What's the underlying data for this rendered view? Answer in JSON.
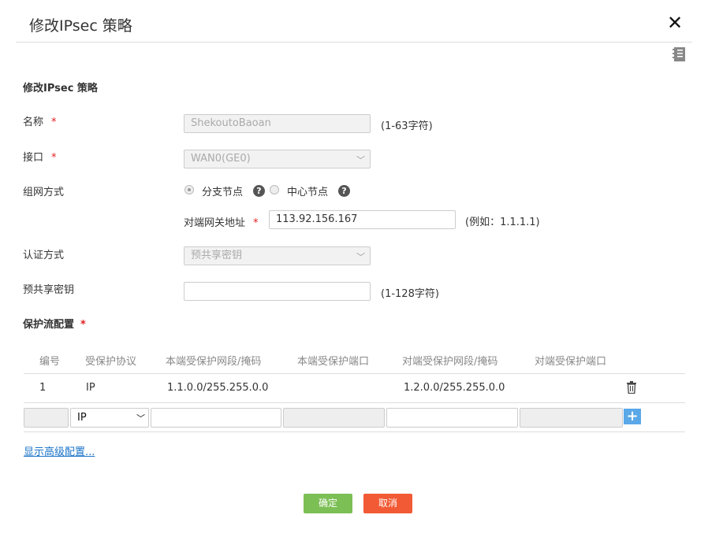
{
  "dialog": {
    "title": "修改IPsec 策略",
    "close_icon": "close-icon",
    "help_icon": "document-icon"
  },
  "section": {
    "title": "修改IPsec 策略"
  },
  "form": {
    "name": {
      "label": "名称",
      "required": "*",
      "value": "ShekoutoBaoan",
      "hint": "(1-63字符)"
    },
    "interface": {
      "label": "接口",
      "required": "*",
      "value": "WAN0(GE0)"
    },
    "mode": {
      "label": "组网方式",
      "branch": "分支节点",
      "center": "中心节点",
      "selected": "分支节点",
      "help": "?"
    },
    "peer": {
      "label": "对端网关地址",
      "required": "*",
      "value": "113.92.156.167",
      "hint": "(例如：1.1.1.1)"
    },
    "auth": {
      "label": "认证方式",
      "value": "预共享密钥"
    },
    "psk": {
      "label": "预共享密钥",
      "value": "",
      "hint": "(1-128字符)"
    }
  },
  "flow": {
    "title": "保护流配置",
    "required": "*",
    "headers": [
      "编号",
      "受保护协议",
      "本端受保护网段/掩码",
      "本端受保护端口",
      "对端受保护网段/掩码",
      "对端受保护端口"
    ],
    "rows": [
      {
        "id": "1",
        "protocol": "IP",
        "local_net": "1.1.0.0/255.255.0.0",
        "local_port": "",
        "remote_net": "1.2.0.0/255.255.0.0",
        "remote_port": ""
      }
    ],
    "new_row": {
      "protocol": "IP",
      "add": "+"
    }
  },
  "advanced_link": "显示高级配置...",
  "buttons": {
    "ok": "确定",
    "cancel": "取消"
  },
  "colors": {
    "ok": "#7cbf55",
    "cancel": "#f25a35",
    "required": "#e02020",
    "link": "#1a73c8",
    "add": "#5aa8e8"
  }
}
